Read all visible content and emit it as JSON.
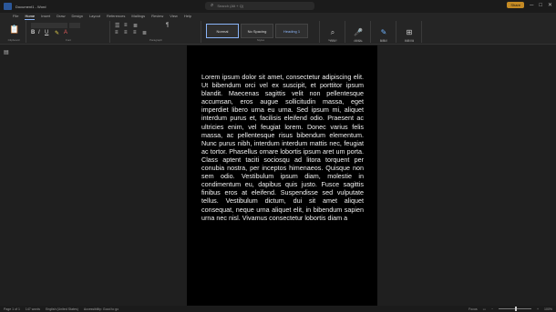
{
  "titlebar": {
    "doc_title": "Document1 - Word",
    "search_placeholder": "Search (Alt + Q)",
    "share_label": "Share"
  },
  "ribbon": {
    "tabs": [
      "File",
      "Home",
      "Insert",
      "Draw",
      "Design",
      "Layout",
      "References",
      "Mailings",
      "Review",
      "View",
      "Help"
    ],
    "groups": {
      "clipboard": "Clipboard",
      "font": "Font",
      "paragraph": "Paragraph",
      "styles": "Styles",
      "editing": "Editing",
      "voice": "Voice",
      "editor": "Editor",
      "addins": "Add-ins"
    },
    "styles": [
      "Normal",
      "No Spacing",
      "Heading 1"
    ],
    "tools": {
      "find": "Find",
      "dictate": "Dictate",
      "editor": "Editor",
      "addins": "Add-ins"
    }
  },
  "document": {
    "text": "Lorem ipsum dolor sit amet, consectetur adipiscing elit. Ut bibendum orci vel ex suscipit, et porttitor ipsum blandit. Maecenas sagittis velit non pellentesque accumsan, eros augue sollicitudin massa, eget imperdiet libero urna eu urna. Sed ipsum mi, aliquet interdum purus et, facilisis eleifend odio. Praesent ac ultricies enim, vel feugiat lorem. Donec varius felis massa, ac pellentesque risus bibendum elementum. Nunc purus nibh, interdum interdum mattis nec, feugiat ac tortor. Phasellus ornare lobortis ipsum aret um porta. Class aptent taciti sociosqu ad litora torquent per conubia nostra, per inceptos himenaeos. Quisque non sem odio. Vestibulum ipsum diam, molestie in condimentum eu, dapibus quis justo. Fusce sagittis finibus eros at eleifend. Suspendisse sed vulputate tellus. Vestibulum dictum, dui sit amet aliquet consequat, neque urna aliquet elit, in bibendum sapien urna nec nisl. Vivamus consectetur lobortis diam a"
  },
  "statusbar": {
    "page": "Page 1 of 1",
    "words": "147 words",
    "language": "English (United States)",
    "accessibility": "Accessibility: Good to go",
    "focus": "Focus",
    "zoom": "100%"
  }
}
